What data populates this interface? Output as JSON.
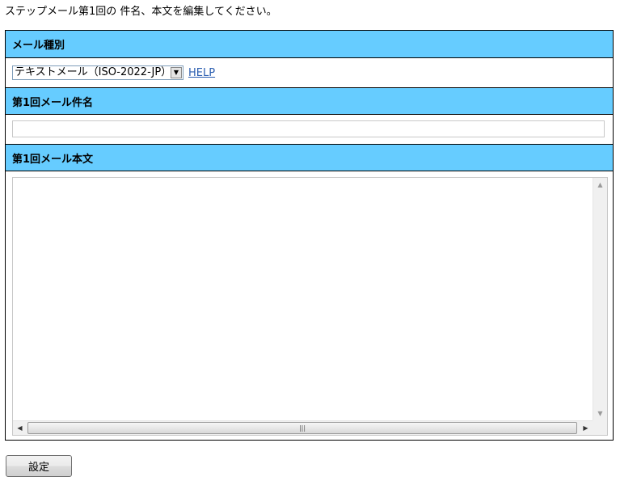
{
  "intro_text": "ステップメール第1回の 件名、本文を編集してください。",
  "sections": {
    "mail_type": {
      "header": "メール種別",
      "selected_value": "テキストメール（ISO-2022-JP）",
      "help_label": "HELP"
    },
    "subject": {
      "header": "第1回メール件名",
      "value": "",
      "placeholder": ""
    },
    "body": {
      "header": "第1回メール本文",
      "value": ""
    }
  },
  "submit_label": "設定",
  "icons": {
    "select_arrow": "chevron-down-icon",
    "scroll_up": "scroll-up-icon",
    "scroll_down": "scroll-down-icon",
    "scroll_left": "scroll-left-icon",
    "scroll_right": "scroll-right-icon"
  },
  "colors": {
    "header_bg": "#66ccff",
    "link": "#2a5db0"
  }
}
